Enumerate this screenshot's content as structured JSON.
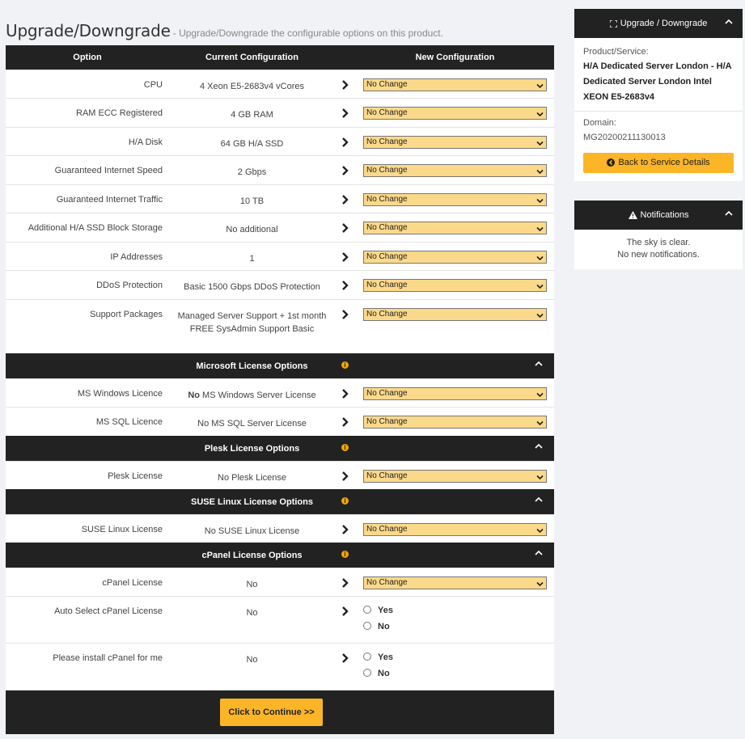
{
  "page": {
    "title": "Upgrade/Downgrade",
    "subtitle": "- Upgrade/Downgrade the configurable options on this product."
  },
  "table": {
    "headers": {
      "option": "Option",
      "current": "Current Configuration",
      "new": "New Configuration"
    },
    "default_select": "No Change",
    "rows": [
      {
        "label": "CPU",
        "current": "4 Xeon E5-2683v4 vCores",
        "value": "No Change"
      },
      {
        "label": "RAM ECC Registered",
        "current": "4 GB RAM",
        "value": "No Change"
      },
      {
        "label": "H/A Disk",
        "current": "64 GB H/A SSD",
        "value": "No Change"
      },
      {
        "label": "Guaranteed Internet Speed",
        "current": "2 Gbps",
        "value": "No Change"
      },
      {
        "label": "Guaranteed Internet Traffic",
        "current": "10 TB",
        "value": "No Change"
      },
      {
        "label": "Additional H/A SSD Block Storage",
        "current": "No additional",
        "value": "No Change"
      },
      {
        "label": "IP Addresses",
        "current": "1",
        "value": "No Change"
      },
      {
        "label": "DDoS Protection",
        "current": "Basic 1500 Gbps DDoS Protection",
        "value": "No Change"
      },
      {
        "label": "Support Packages",
        "current": "Managed Server Support + 1st month FREE SysAdmin Support Basic",
        "value": "No Change"
      }
    ],
    "sections": [
      {
        "title": "Microsoft License Options",
        "rows": [
          {
            "label": "MS Windows Licence",
            "current_bold": "No",
            "current": " MS Windows Server License",
            "value": "No Change"
          },
          {
            "label": "MS SQL Licence",
            "current": "No MS SQL Server License",
            "value": "No Change"
          }
        ]
      },
      {
        "title": "Plesk License Options",
        "rows": [
          {
            "label": "Plesk License",
            "current": "No Plesk License",
            "value": "No Change"
          }
        ]
      },
      {
        "title": "SUSE Linux License Options",
        "rows": [
          {
            "label": "SUSE Linux License",
            "current": "No SUSE Linux License",
            "value": "No Change"
          }
        ]
      },
      {
        "title": "cPanel License Options",
        "rows": [
          {
            "label": "cPanel License",
            "current": "No",
            "value": "No Change"
          },
          {
            "label": "Auto Select cPanel License",
            "current": "No",
            "radio_yes": "Yes",
            "radio_no": "No"
          },
          {
            "label": "Please install cPanel for me",
            "current": "No",
            "radio_yes": "Yes",
            "radio_no": "No"
          }
        ]
      }
    ],
    "continue_label": "Click to Continue >>"
  },
  "sidebar": {
    "upgrade_panel": {
      "title": "Upgrade / Downgrade",
      "product_label": "Product/Service:",
      "product_value": "H/A Dedicated Server London - H/A Dedicated Server London Intel XEON E5-2683v4",
      "domain_label": "Domain:",
      "domain_value": "MG20200211130013",
      "back_label": "Back to Service Details"
    },
    "notifications_panel": {
      "title": "Notifications",
      "line1": "The sky is clear.",
      "line2": "No new notifications."
    }
  },
  "colors": {
    "accent": "#fbb526",
    "select_bg": "#fbd98a",
    "header_bg": "#222222"
  }
}
